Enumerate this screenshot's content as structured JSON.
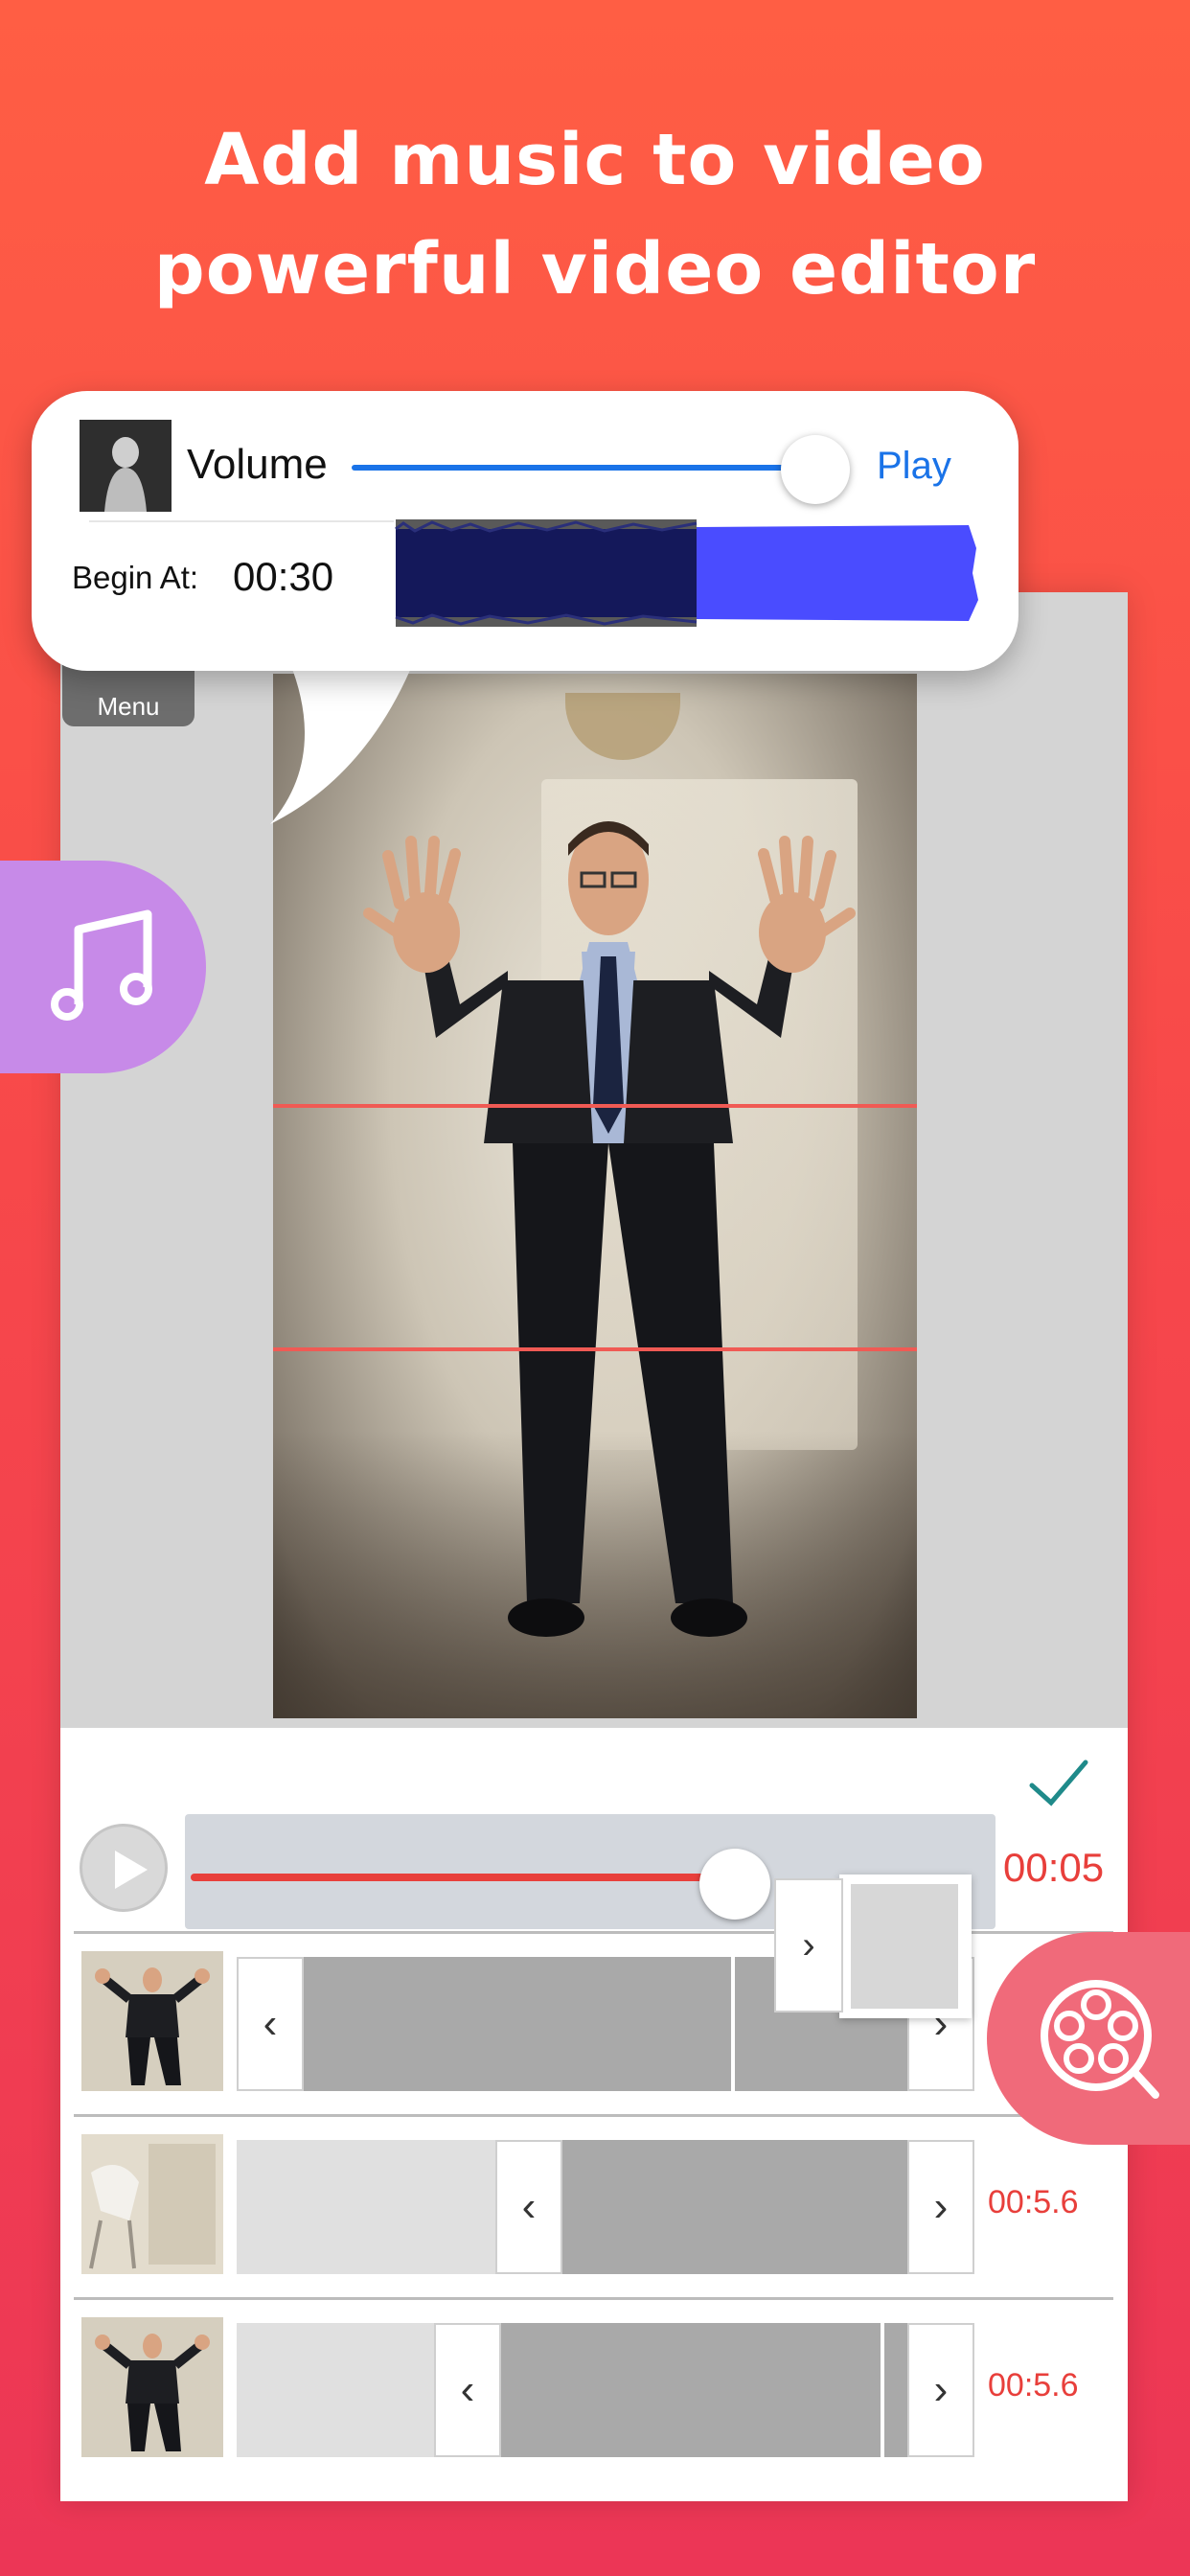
{
  "headline": {
    "line1": "Add music to video",
    "line2": "powerful video editor"
  },
  "menu_button": {
    "label": "Menu"
  },
  "volume_card": {
    "volume_label": "Volume",
    "volume_level": 0.82,
    "play_label": "Play",
    "begin_label": "Begin At:",
    "begin_value": "00:30",
    "accent": "#1a73e8"
  },
  "timeline": {
    "progress": 0.7,
    "current_time": "00:05",
    "clips": [
      {
        "time": ""
      },
      {
        "time": "00:5.6"
      },
      {
        "time": "00:5.6"
      }
    ]
  },
  "colors": {
    "background_top": "#ff5e44",
    "background_bottom": "#ec3656",
    "red_accent": "#e83f3b",
    "music_badge": "#c78ae8",
    "reel_badge": "#f06a7a"
  },
  "icons": [
    "menu-icon",
    "music-note-icon",
    "film-reel-icon",
    "play-icon",
    "checkmark-icon",
    "chevron-left-icon",
    "chevron-right-icon"
  ]
}
